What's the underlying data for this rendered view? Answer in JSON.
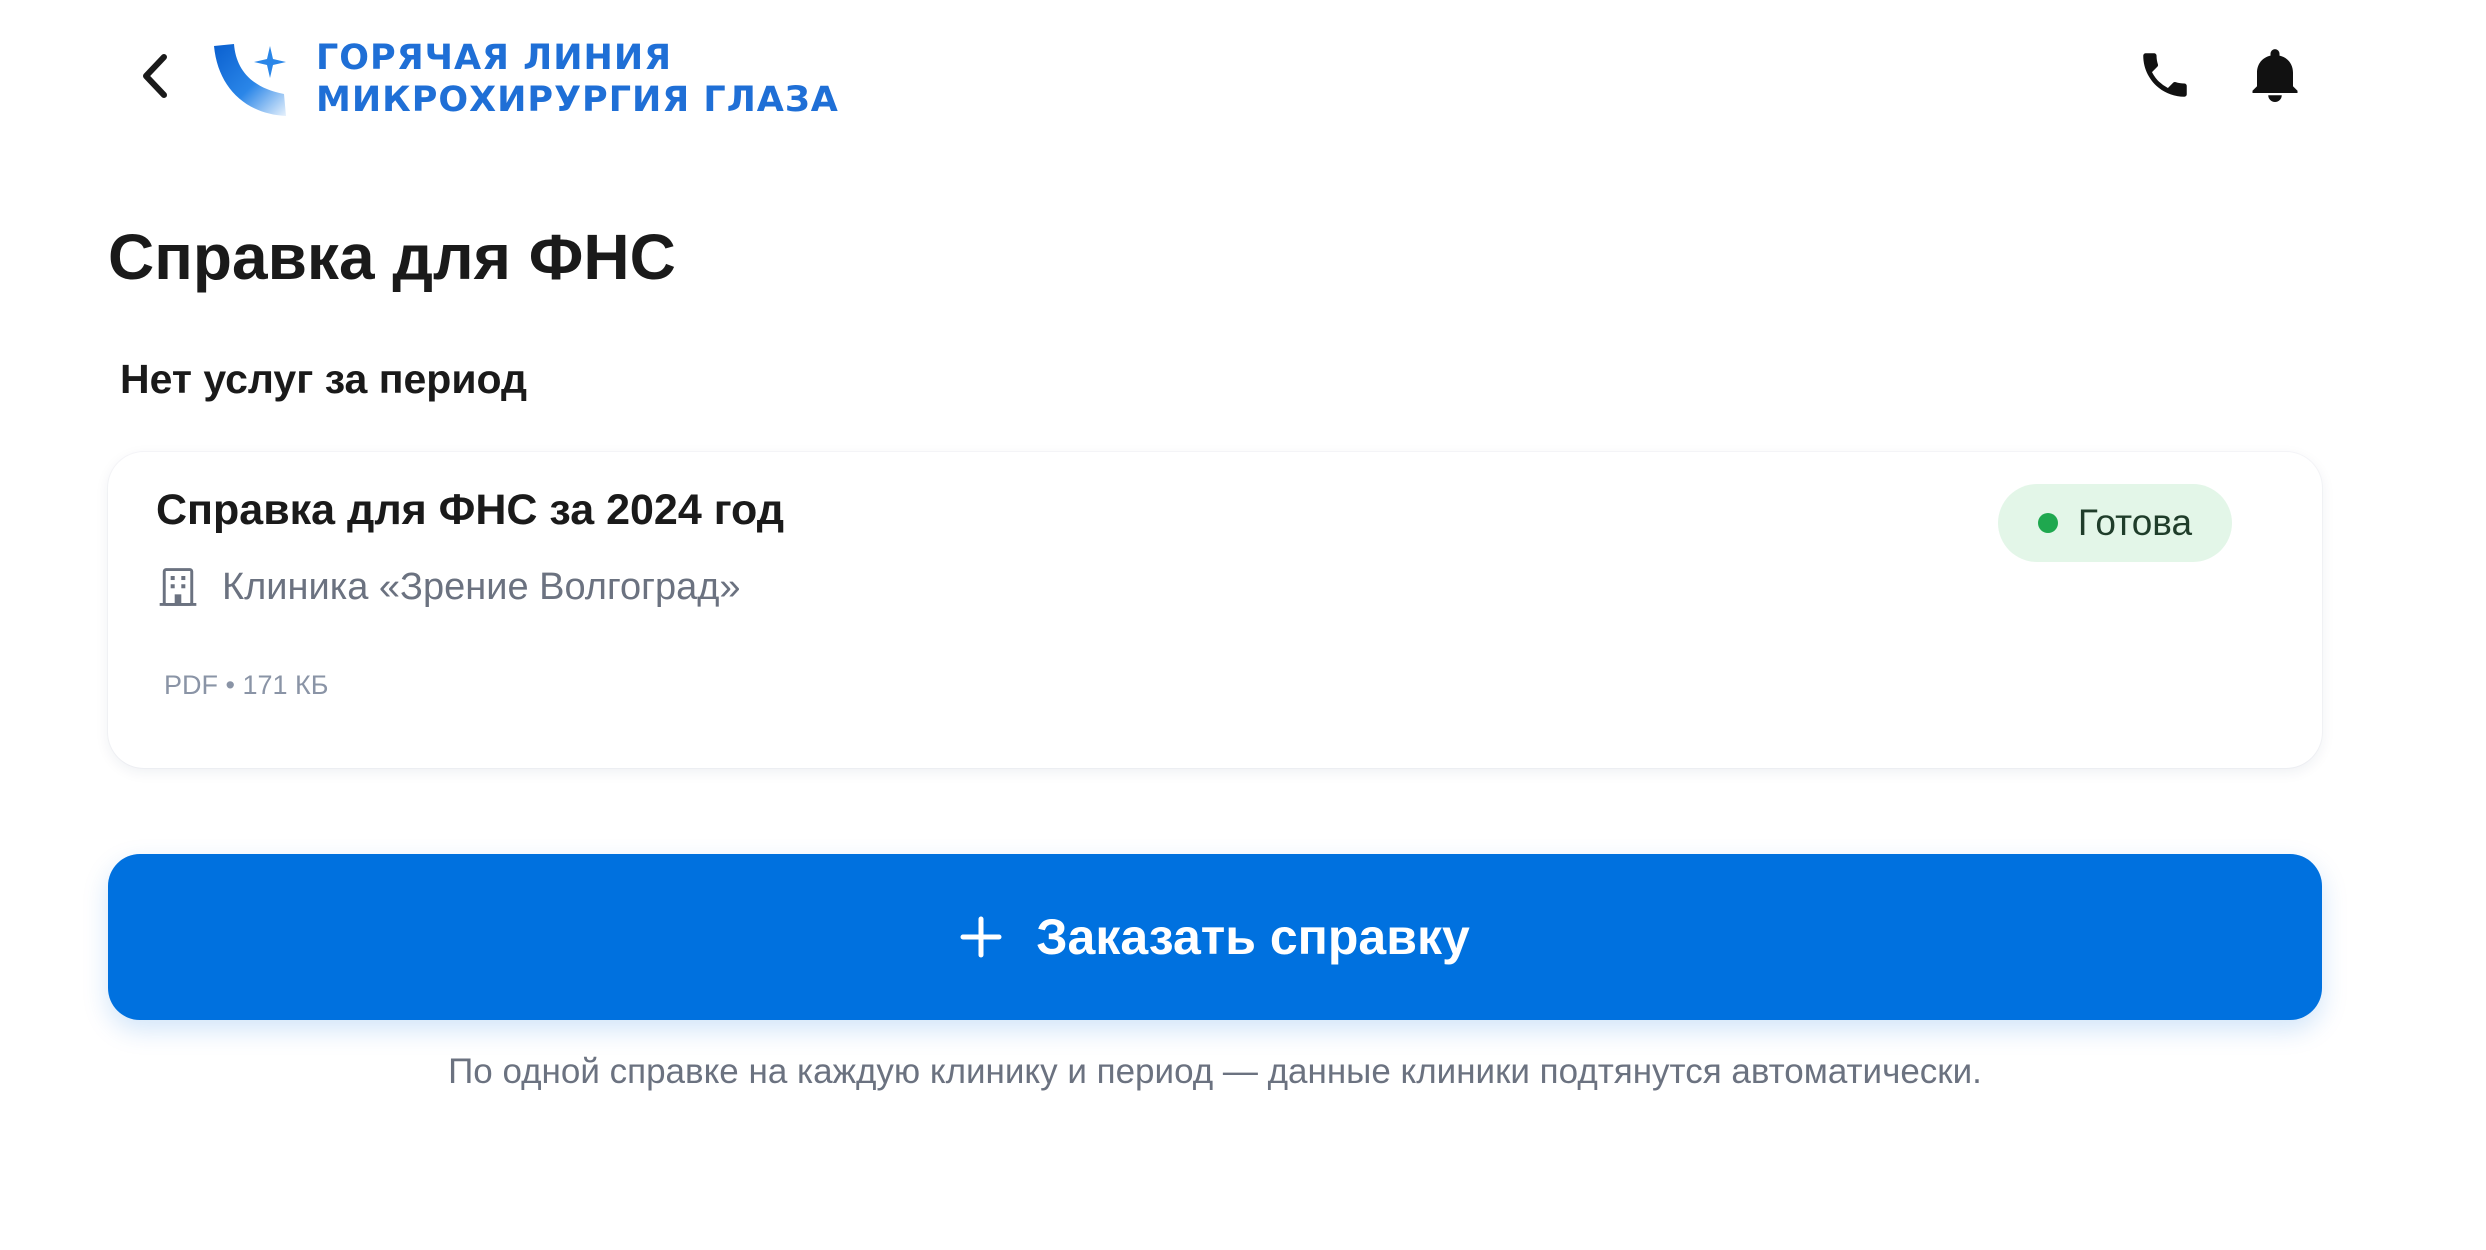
{
  "header": {
    "logo": {
      "line1": "ГОРЯЧАЯ ЛИНИЯ",
      "line2": "МИКРОХИРУРГИЯ ГЛАЗА"
    },
    "icons": {
      "back": "chevron-left-icon",
      "phone": "phone-icon",
      "notifications": "bell-icon"
    }
  },
  "page": {
    "title": "Справка для ФНС",
    "section_title": "Нет услуг за период"
  },
  "certificate_card": {
    "title": "Справка для ФНС за 2024 год",
    "clinic": "Клиника «Зрение Волгоград»",
    "clinic_icon": "building-icon",
    "file_type": "PDF",
    "separator": "•",
    "file_size": "171 КБ",
    "status": {
      "label": "Готова",
      "color": "#1fa84f",
      "background": "#e3f6e8"
    }
  },
  "actions": {
    "order_label": "Заказать справку",
    "order_icon": "plus-icon",
    "order_color": "#0071df"
  },
  "footnote": "По одной справке на каждую клинику и период — данные клиники подтянутся автоматически.",
  "colors": {
    "brand": "#1f6fd6",
    "text": "#1a1a1a",
    "muted": "#6b7280"
  }
}
